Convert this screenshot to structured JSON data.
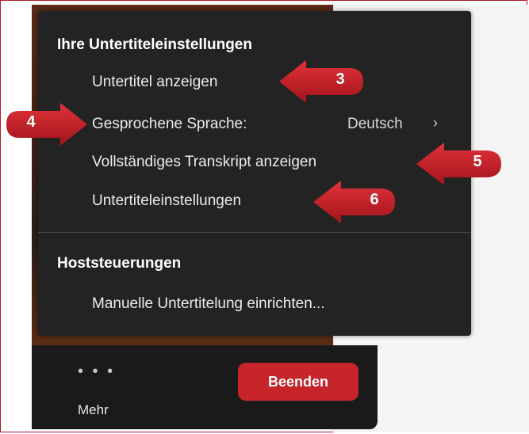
{
  "menu": {
    "section1_title": "Ihre Untertiteleinstellungen",
    "items": [
      {
        "label": "Untertitel anzeigen"
      },
      {
        "label": "Gesprochene Sprache:",
        "value": "Deutsch",
        "chevron": "›"
      },
      {
        "label": "Vollständiges Transkript anzeigen"
      },
      {
        "label": "Untertiteleinstellungen"
      }
    ],
    "section2_title": "Hoststeuerungen",
    "host_items": [
      {
        "label": "Manuelle Untertitelung einrichten..."
      }
    ]
  },
  "toolbar": {
    "more_dots": "• • •",
    "more_label": "Mehr",
    "end_label": "Beenden"
  },
  "callouts": [
    "3",
    "4",
    "5",
    "6"
  ],
  "colors": {
    "accent_red": "#c7252b",
    "menu_bg": "#232323"
  }
}
